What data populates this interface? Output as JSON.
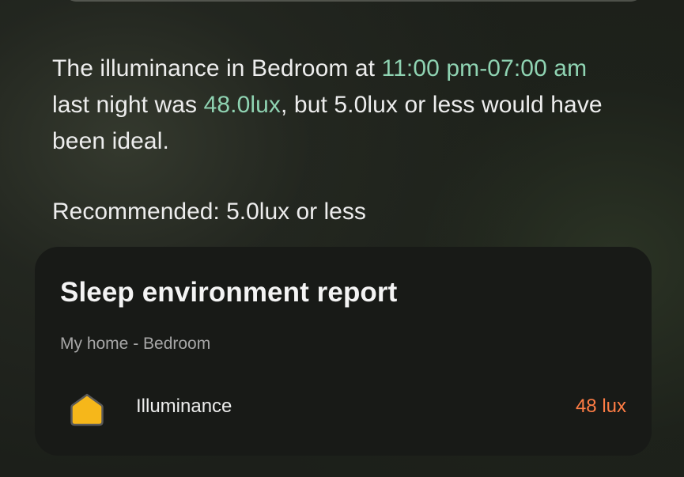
{
  "message": {
    "part1": "The illuminance in Bedroom at ",
    "time_range": "11:00 pm-07:00 am",
    "part2": " last night was ",
    "measured": "48.0lux",
    "part3": ", but 5.0lux or less would have been ideal."
  },
  "recommended": "Recommended: 5.0lux or less",
  "report": {
    "title": "Sleep environment report",
    "location": "My home - Bedroom",
    "sensor": {
      "icon": "home-icon",
      "label": "Illuminance",
      "value": "48 lux",
      "value_color": "#ff7d45"
    }
  },
  "colors": {
    "highlight": "#8fd3b2",
    "warning": "#ff7d45",
    "icon_fill": "#f6b71a"
  }
}
